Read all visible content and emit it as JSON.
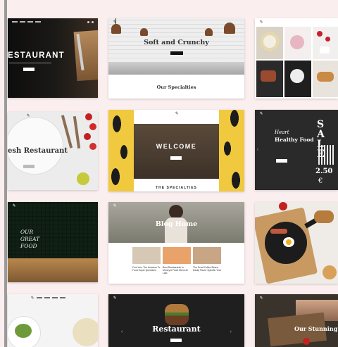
{
  "cards": {
    "restaurant_dark": {
      "title": "ESTAURANT"
    },
    "soft_crunchy": {
      "title": "Soft and Crunchy",
      "section": "Our Specialties"
    },
    "fresh_restaurant": {
      "title": "esh Restaurant"
    },
    "welcome": {
      "title": "WELCOME",
      "section": "THE SPECIALTIES"
    },
    "healthy_food": {
      "title": "Healthy Food",
      "script_title": "Heart",
      "sale_big": "SALE",
      "price": "2.50",
      "currency": "€"
    },
    "our_great_food": {
      "title": "OUR GREAT FOOD"
    },
    "blog_home": {
      "title": "Blog Home",
      "posts": [
        "Find Your The Answers To Food Super Questions",
        "Best Restaurants In Money A Fixed Menu At Last",
        "The Scraf Coffee Beans Easily Flavor Specific Year"
      ]
    },
    "restaurant_bottom": {
      "title": "Restaurant"
    },
    "stunning": {
      "title": "Our Stunning Ki"
    }
  }
}
